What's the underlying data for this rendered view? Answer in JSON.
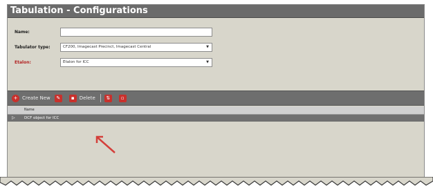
{
  "window": {
    "title": "Tabulation - Configurations"
  },
  "form": {
    "name_label": "Name:",
    "name_value": "",
    "tabulator_type_label": "Tabulator type:",
    "tabulator_type_value": "CF200, Imagecast Precinct, Imagecast Central",
    "etalon_label": "Etalon:",
    "etalon_value": "Etalon for ICC"
  },
  "toolbar": {
    "create_new_label": "Create New",
    "delete_label": "Delete"
  },
  "grid": {
    "columns": [
      "Name"
    ],
    "rows": [
      "DCF object for ICC"
    ]
  },
  "colors": {
    "title_bar": "#6b6b6b",
    "panel": "#d8d6cb",
    "toolbar": "#6e6e6e",
    "icon_red": "#c9302c",
    "arrow": "#d43f3a"
  },
  "icons": [
    "create-new-icon",
    "edit-icon",
    "delete-icon",
    "move-icon",
    "clone-icon",
    "expand-icon",
    "dropdown-arrow-icon"
  ]
}
